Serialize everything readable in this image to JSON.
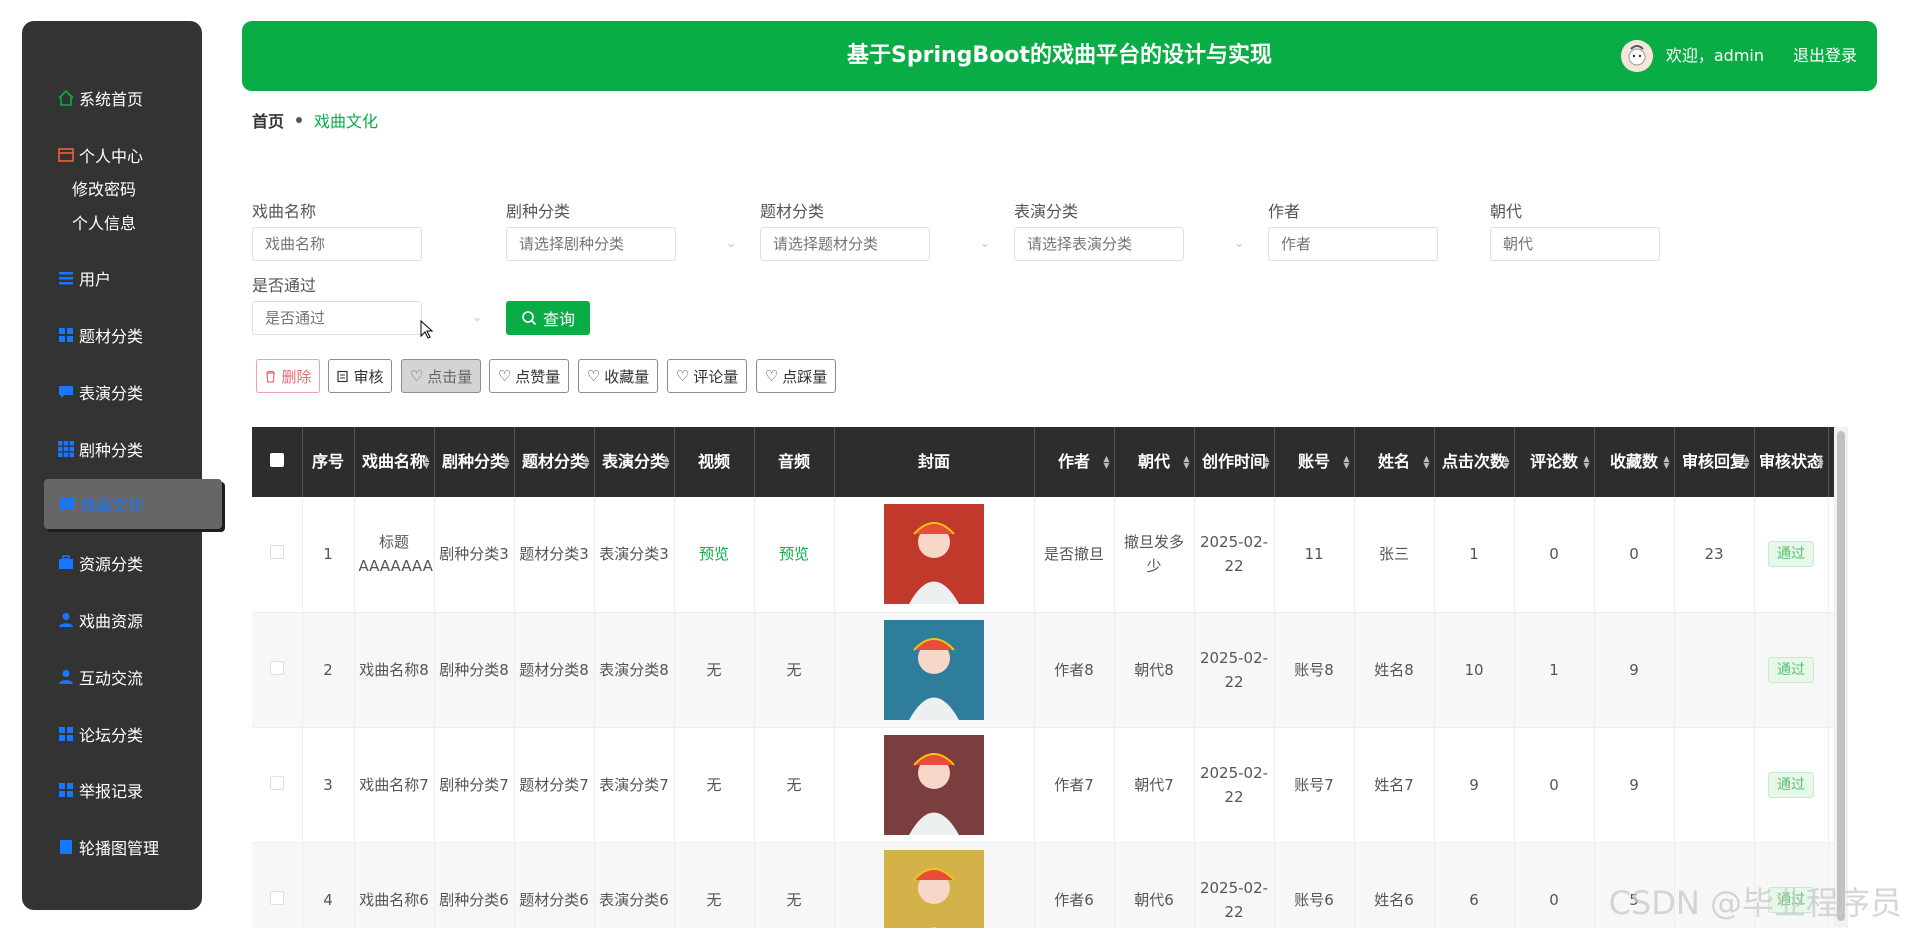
{
  "sidebar": {
    "items": [
      {
        "label": "系统首页",
        "icon": "home-icon"
      },
      {
        "label": "个人中心",
        "icon": "card-icon"
      },
      {
        "label": "用户",
        "icon": "list-icon"
      },
      {
        "label": "题材分类",
        "icon": "grid-icon"
      },
      {
        "label": "表演分类",
        "icon": "chat-icon"
      },
      {
        "label": "剧种分类",
        "icon": "grid9-icon"
      },
      {
        "label": "戏曲文化",
        "icon": "book-icon"
      },
      {
        "label": "资源分类",
        "icon": "briefcase-icon"
      },
      {
        "label": "戏曲资源",
        "icon": "user-icon"
      },
      {
        "label": "互动交流",
        "icon": "user-icon"
      },
      {
        "label": "论坛分类",
        "icon": "grid-icon"
      },
      {
        "label": "举报记录",
        "icon": "grid-icon"
      },
      {
        "label": "轮播图管理",
        "icon": "book-icon"
      }
    ],
    "sub_items": [
      "修改密码",
      "个人信息"
    ],
    "active": "戏曲文化"
  },
  "header": {
    "title": "基于SpringBoot的戏曲平台的设计与实现",
    "welcome": "欢迎，admin",
    "logout": "退出登录"
  },
  "breadcrumb": {
    "home": "首页",
    "current": "戏曲文化"
  },
  "search": {
    "name_label": "戏曲名称",
    "name_placeholder": "戏曲名称",
    "genre_label": "剧种分类",
    "genre_placeholder": "请选择剧种分类",
    "theme_label": "题材分类",
    "theme_placeholder": "请选择题材分类",
    "perf_label": "表演分类",
    "perf_placeholder": "请选择表演分类",
    "author_label": "作者",
    "author_placeholder": "作者",
    "dynasty_label": "朝代",
    "dynasty_placeholder": "朝代",
    "pass_label": "是否通过",
    "pass_placeholder": "是否通过",
    "query_button": "查询"
  },
  "actions": {
    "delete": "删除",
    "audit": "审核",
    "clicks": "点击量",
    "likes": "点赞量",
    "favorites": "收藏量",
    "comments": "评论量",
    "dislikes": "点踩量"
  },
  "table": {
    "headers": [
      "序号",
      "戏曲名称",
      "剧种分类",
      "题材分类",
      "表演分类",
      "视频",
      "音频",
      "封面",
      "作者",
      "朝代",
      "创作时间",
      "账号",
      "姓名",
      "点击次数",
      "评论数",
      "收藏数",
      "审核回复",
      "审核状态"
    ],
    "rows": [
      {
        "no": "1",
        "name": "标题AAAAAAA",
        "genre": "剧种分类3",
        "theme": "题材分类3",
        "perf": "表演分类3",
        "video": "预览",
        "audio": "预览",
        "author": "是否撤旦",
        "dynasty": "撤旦发多少",
        "time": "2025-02-22",
        "account": "11",
        "person": "张三",
        "clicks": "1",
        "comments": "0",
        "favs": "0",
        "reply": "23",
        "status": "通过",
        "cover_color": "#c0392b"
      },
      {
        "no": "2",
        "name": "戏曲名称8",
        "genre": "剧种分类8",
        "theme": "题材分类8",
        "perf": "表演分类8",
        "video": "无",
        "audio": "无",
        "author": "作者8",
        "dynasty": "朝代8",
        "time": "2025-02-22",
        "account": "账号8",
        "person": "姓名8",
        "clicks": "10",
        "comments": "1",
        "favs": "9",
        "reply": "",
        "status": "通过",
        "cover_color": "#2e7d9a"
      },
      {
        "no": "3",
        "name": "戏曲名称7",
        "genre": "剧种分类7",
        "theme": "题材分类7",
        "perf": "表演分类7",
        "video": "无",
        "audio": "无",
        "author": "作者7",
        "dynasty": "朝代7",
        "time": "2025-02-22",
        "account": "账号7",
        "person": "姓名7",
        "clicks": "9",
        "comments": "0",
        "favs": "9",
        "reply": "",
        "status": "通过",
        "cover_color": "#7a3e3e"
      },
      {
        "no": "4",
        "name": "戏曲名称6",
        "genre": "剧种分类6",
        "theme": "题材分类6",
        "perf": "表演分类6",
        "video": "无",
        "audio": "无",
        "author": "作者6",
        "dynasty": "朝代6",
        "time": "2025-02-22",
        "account": "账号6",
        "person": "姓名6",
        "clicks": "6",
        "comments": "0",
        "favs": "5",
        "reply": "",
        "status": "通过",
        "cover_color": "#d4b24a"
      }
    ]
  },
  "watermark": "CSDN @毕业程序员",
  "colors": {
    "accent": "#0aad45",
    "sidebar": "#333333",
    "active_text": "#1677ff",
    "table_header": "#2d2d2d"
  }
}
